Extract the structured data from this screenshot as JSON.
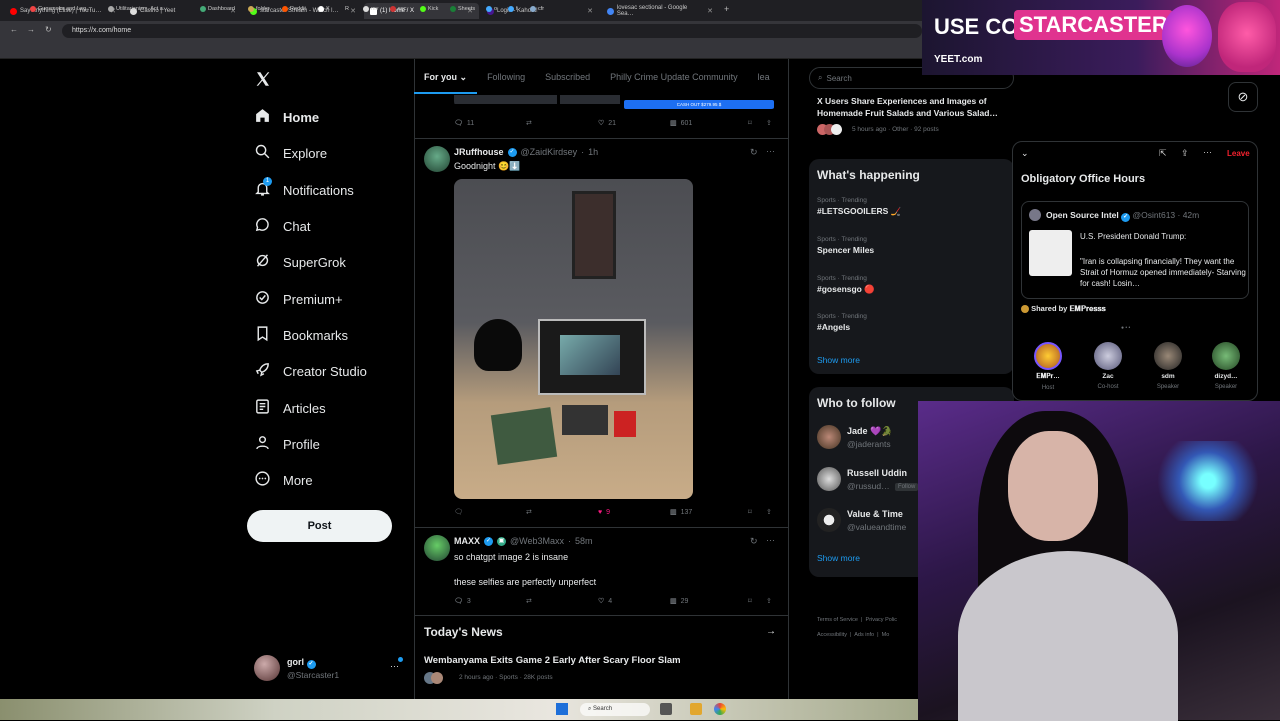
{
  "browser": {
    "tabs": [
      {
        "label": "Say Anything (Elise) | YouTu…",
        "color": "#ff0000"
      },
      {
        "label": "Casino | Yeet",
        "color": "#ffffff"
      },
      {
        "label": "starcaster Stream - Watch l…",
        "color": "#53fc18"
      },
      {
        "label": "(1) Home / X",
        "color": "#ffffff",
        "active": true
      },
      {
        "label": "Login - Kahoot!",
        "color": "#46178f"
      },
      {
        "label": "lovesac sectional - Google Sea…",
        "color": "#4285f4"
      }
    ],
    "url": "https://x.com/home",
    "bookmarks": [
      "Gunsmoke and Leg…",
      "Utilitarianism, Act a…",
      "Dashboard",
      "folder",
      "Reddit",
      "X",
      "R",
      "mv",
      "sec",
      "Kick",
      "Sheets",
      "o",
      "f",
      "cfr"
    ]
  },
  "sidebar": {
    "items": [
      {
        "label": "Home",
        "icon": "home-icon"
      },
      {
        "label": "Explore",
        "icon": "search-icon"
      },
      {
        "label": "Notifications",
        "icon": "bell-icon",
        "badge": "1"
      },
      {
        "label": "Chat",
        "icon": "chat-icon"
      },
      {
        "label": "SuperGrok",
        "icon": "grok-icon"
      },
      {
        "label": "Premium+",
        "icon": "premium-icon"
      },
      {
        "label": "Bookmarks",
        "icon": "bookmark-icon"
      },
      {
        "label": "Creator Studio",
        "icon": "rocket-icon"
      },
      {
        "label": "Articles",
        "icon": "articles-icon"
      },
      {
        "label": "Profile",
        "icon": "profile-icon"
      },
      {
        "label": "More",
        "icon": "more-icon"
      }
    ],
    "post_label": "Post",
    "account": {
      "name": "gorl",
      "handle": "@Starcaster1"
    }
  },
  "feed": {
    "tabs": [
      "For you",
      "Following",
      "Subscribed",
      "Philly Crime Update Community",
      "lea"
    ],
    "prev_stats": {
      "replies": "11",
      "likes": "21",
      "views": "601"
    },
    "prev_media_text": "CASH OUT $279.95 $",
    "tweet1": {
      "name": "JRuffhouse",
      "handle": "@ZaidKirdsey",
      "time": "1h",
      "text": "Goodnight 😊⬇️",
      "views": "137",
      "likes": "9"
    },
    "tweet2": {
      "name": "MAXX",
      "handle": "@Web3Maxx",
      "time": "58m",
      "text1": "so chatgpt image 2 is insane",
      "text2": "these selfies are perfectly unperfect",
      "replies": "3",
      "likes": "4",
      "views": "29"
    },
    "news": {
      "heading": "Today's News",
      "title": "Wembanyama Exits Game 2 Early After Scary Floor Slam",
      "meta": "2 hours ago · Sports · 28K posts"
    }
  },
  "right": {
    "search_placeholder": "Search",
    "story": {
      "title": "X Users Share Experiences and Images of Homemade Fruit Salads and Various Salad…",
      "meta": "5 hours ago · Other · 92 posts"
    },
    "happening_title": "What's happening",
    "trends": [
      {
        "cat": "Sports · Trending",
        "name": "#LETSGOOILERS 🏒"
      },
      {
        "cat": "Sports · Trending",
        "name": "Spencer Miles"
      },
      {
        "cat": "Sports · Trending",
        "name": "#gosensgo 🔴"
      },
      {
        "cat": "Sports · Trending",
        "name": "#Angels"
      }
    ],
    "show_more": "Show more",
    "follow_title": "Who to follow",
    "follows": [
      {
        "name": "Jade 💜🐊",
        "handle": "@jaderants"
      },
      {
        "name": "Russell Uddin",
        "handle": "@russud…",
        "tag": "Follow"
      },
      {
        "name": "Value & Time",
        "handle": "@valueandtime"
      }
    ],
    "footer": [
      "Terms of Service",
      "|",
      "Privacy Polic",
      "Accessibility",
      "|",
      "Ads info",
      "|",
      "Mo"
    ]
  },
  "space": {
    "leave": "Leave",
    "title": "Obligatory Office Hours",
    "post_name": "Open Source Intel",
    "post_handle": "@Osint613 · 42m",
    "post_line1": "U.S. President Donald Trump:",
    "post_line2": "\"Iran is collapsing financially! They want the Strait of Hormuz opened immediately- Starving for cash! Losin…",
    "shared_by": "Shared by 𝐄𝐌𝐏𝐫𝐞𝐬𝐬𝐬",
    "speakers": [
      {
        "name": "𝐄𝐌𝐏𝐫…",
        "role": "Host"
      },
      {
        "name": "Zac",
        "role": "Co-host"
      },
      {
        "name": "sdm",
        "role": "Speaker"
      },
      {
        "name": "dizyd…",
        "role": "Speaker"
      }
    ]
  },
  "overlay": {
    "ad_text": "USE CODE:",
    "ad_code": "STARCASTER",
    "ad_brand": "YEET.com"
  },
  "taskbar": {
    "search": "Search"
  }
}
